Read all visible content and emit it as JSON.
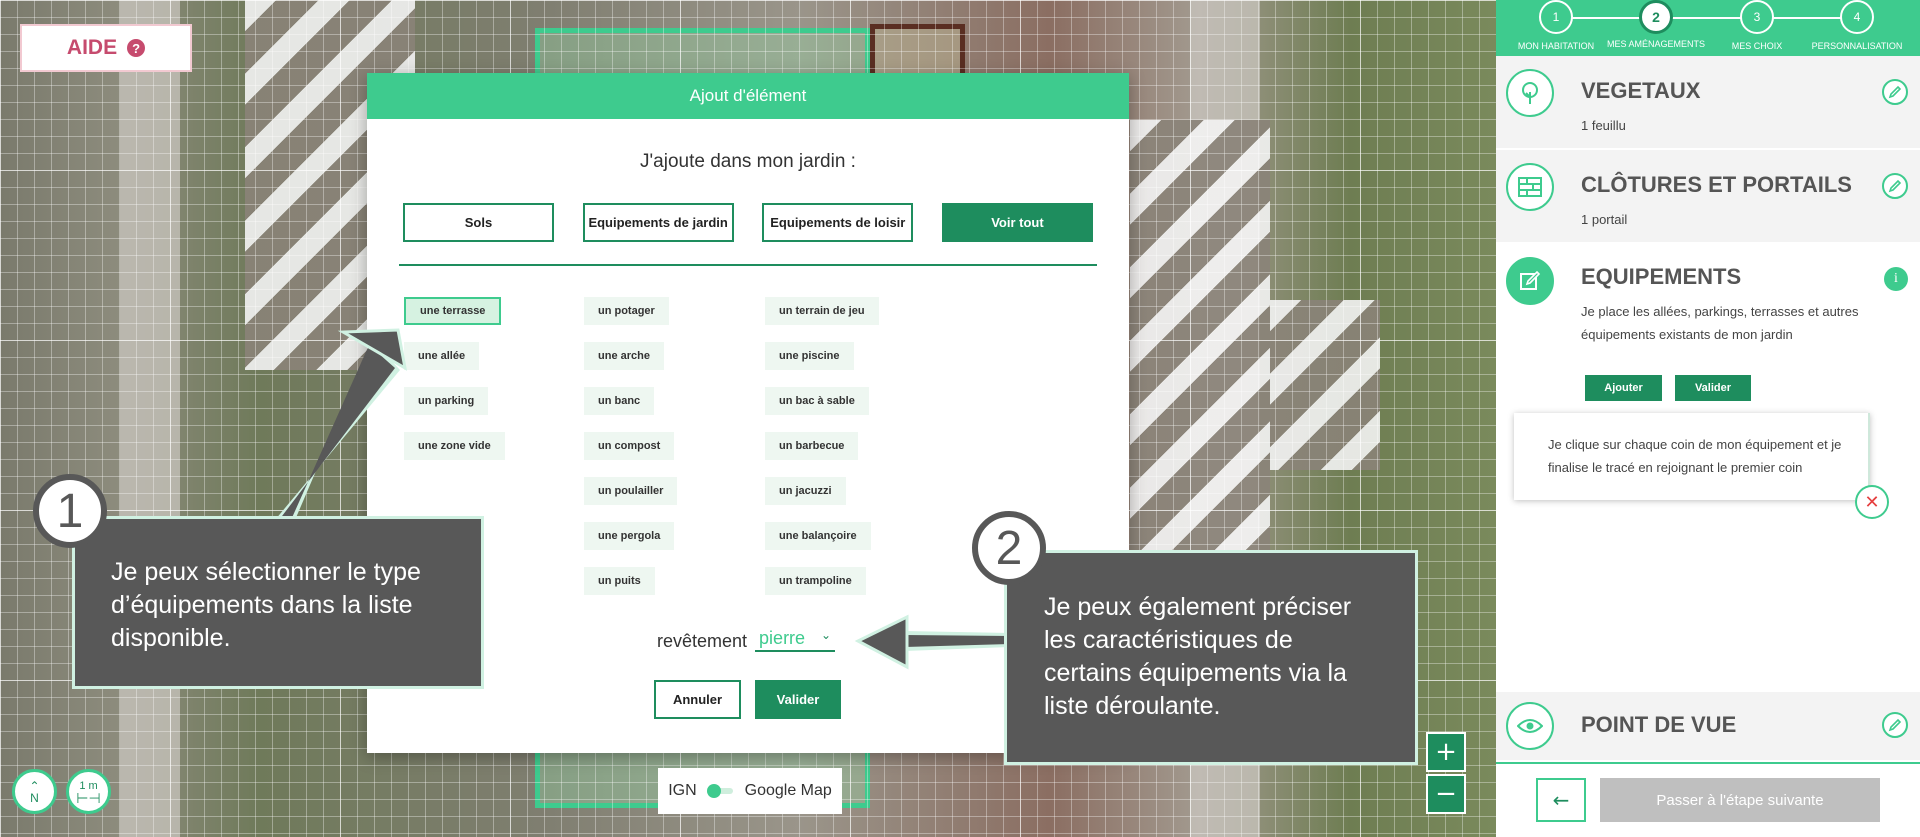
{
  "help": {
    "label": "AIDE",
    "icon": "help-icon"
  },
  "modal": {
    "title": "Ajout d'élément",
    "subtitle": "J'ajoute dans mon jardin :",
    "categories": [
      {
        "label": "Sols",
        "active": false
      },
      {
        "label": "Equipements de jardin",
        "active": false
      },
      {
        "label": "Equipements de loisir",
        "active": false
      },
      {
        "label": "Voir tout",
        "active": true
      }
    ],
    "columns": [
      [
        "une terrasse",
        "une allée",
        "un parking",
        "une zone vide"
      ],
      [
        "un potager",
        "une arche",
        "un banc",
        "un compost",
        "un poulailler",
        "une pergola",
        "un puits"
      ],
      [
        "un terrain de jeu",
        "une piscine",
        "un bac à sable",
        "un barbecue",
        "un jacuzzi",
        "une balançoire",
        "un trampoline"
      ]
    ],
    "selected_item": "une terrasse",
    "revetement_label": "revêtement",
    "revetement_value": "pierre",
    "cancel_label": "Annuler",
    "confirm_label": "Valider"
  },
  "map_controls": {
    "layer_left": "IGN",
    "layer_right": "Google Map",
    "north_label": "N",
    "scale_label": "1 m",
    "zoom_in": "+",
    "zoom_out": "−"
  },
  "callouts": [
    {
      "number": "1",
      "text": "Je peux sélectionner le type d’équipements dans la liste disponible."
    },
    {
      "number": "2",
      "text": "Je peux également préciser les caractéristiques de certains équipements via la liste déroulante."
    }
  ],
  "sidebar": {
    "steps": [
      {
        "number": "1",
        "label": "MON HABITATION"
      },
      {
        "number": "2",
        "label": "MES AMÉNAGEMENTS",
        "current": true
      },
      {
        "number": "3",
        "label": "MES CHOIX"
      },
      {
        "number": "4",
        "label": "PERSONNALISATION"
      }
    ],
    "sections": [
      {
        "title": "VEGETAUX",
        "sub": "1 feuillu",
        "icon": "tree-icon"
      },
      {
        "title": "CLÔTURES ET PORTAILS",
        "sub": "1 portail",
        "icon": "fence-icon"
      },
      {
        "title": "EQUIPEMENTS",
        "sub": "Je place les allées, parkings, terrasses et autres équipements existants de mon jardin",
        "icon": "edit-square-icon"
      },
      {
        "title": "POINT DE VUE",
        "icon": "eye-icon"
      }
    ],
    "add_label": "Ajouter",
    "validate_label": "Valider",
    "hint": "Je clique sur chaque coin de mon équipement et je finalise le tracé en rejoignant le premier coin",
    "next_label": "Passer à l'étape suivante"
  },
  "colors": {
    "accent": "#3ecb8e",
    "accent_dark": "#1e8d5e",
    "callout": "#585858",
    "help": "#c64b6e"
  }
}
